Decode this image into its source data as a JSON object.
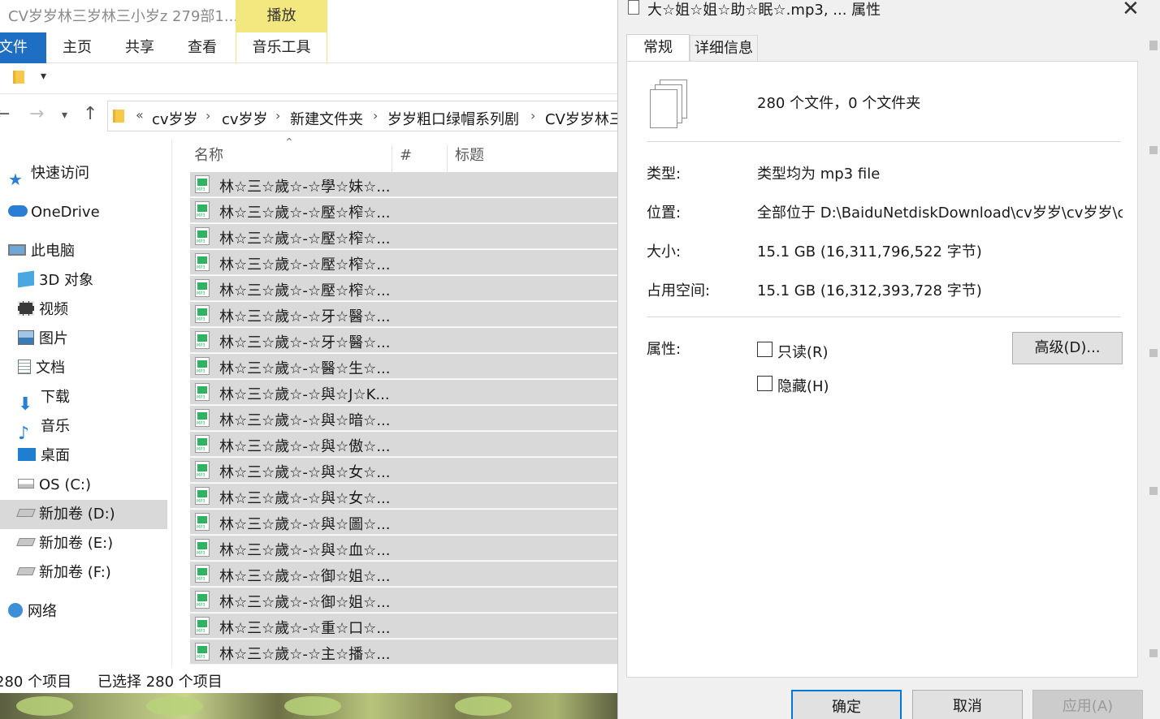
{
  "explorer": {
    "title": "CV岁岁林三岁林三小岁z 279部1...",
    "play_tab": "播放",
    "ribbon": {
      "file": "文件",
      "home": "主页",
      "share": "共享",
      "view": "查看",
      "music_tools": "音乐工具"
    },
    "address": {
      "overflow": "«",
      "segments": [
        "cv岁岁",
        "cv岁岁",
        "新建文件夹",
        "岁岁粗口绿帽系列剧",
        "CV岁岁林三"
      ]
    },
    "sidebar": [
      {
        "label": "快速访问",
        "icon": "star-icon"
      },
      {
        "label": "OneDrive",
        "icon": "cloud-icon"
      },
      {
        "label": "此电脑",
        "icon": "computer-icon"
      },
      {
        "label": "3D 对象",
        "icon": "cube-icon"
      },
      {
        "label": "视频",
        "icon": "video-icon"
      },
      {
        "label": "图片",
        "icon": "picture-icon"
      },
      {
        "label": "文档",
        "icon": "document-icon"
      },
      {
        "label": "下载",
        "icon": "download-icon"
      },
      {
        "label": "音乐",
        "icon": "music-icon"
      },
      {
        "label": "桌面",
        "icon": "desktop-icon"
      },
      {
        "label": "OS (C:)",
        "icon": "drive-c-icon"
      },
      {
        "label": "新加卷 (D:)",
        "icon": "drive-icon"
      },
      {
        "label": "新加卷 (E:)",
        "icon": "drive-icon"
      },
      {
        "label": "新加卷 (F:)",
        "icon": "drive-icon"
      },
      {
        "label": "网络",
        "icon": "network-icon"
      }
    ],
    "columns": {
      "name": "名称",
      "number": "#",
      "title": "标题"
    },
    "files": [
      "林☆三☆歲☆-☆學☆妹☆...",
      "林☆三☆歲☆-☆壓☆榨☆...",
      "林☆三☆歲☆-☆壓☆榨☆...",
      "林☆三☆歲☆-☆壓☆榨☆...",
      "林☆三☆歲☆-☆壓☆榨☆...",
      "林☆三☆歲☆-☆牙☆醫☆...",
      "林☆三☆歲☆-☆牙☆醫☆...",
      "林☆三☆歲☆-☆醫☆生☆...",
      "林☆三☆歲☆-☆與☆J☆K...",
      "林☆三☆歲☆-☆與☆暗☆...",
      "林☆三☆歲☆-☆與☆傲☆...",
      "林☆三☆歲☆-☆與☆女☆...",
      "林☆三☆歲☆-☆與☆女☆...",
      "林☆三☆歲☆-☆與☆圖☆...",
      "林☆三☆歲☆-☆與☆血☆...",
      "林☆三☆歲☆-☆御☆姐☆...",
      "林☆三☆歲☆-☆御☆姐☆...",
      "林☆三☆歲☆-☆重☆口☆...",
      "林☆三☆歲☆-☆主☆播☆..."
    ],
    "status": {
      "count": "280 个项目",
      "selected": "已选择 280 个项目"
    }
  },
  "dialog": {
    "title": "大☆姐☆姐☆助☆眠☆.mp3, ... 属性",
    "tabs": {
      "general": "常规",
      "details": "详细信息"
    },
    "summary": "280 个文件，0 个文件夹",
    "type_label": "类型:",
    "type_value": "类型均为 mp3 file",
    "location_label": "位置:",
    "location_value": "全部位于 D:\\BaiduNetdiskDownload\\cv岁岁\\cv岁岁\\cv",
    "size_label": "大小:",
    "size_value": "15.1 GB (16,311,796,522 字节)",
    "disk_label": "占用空间:",
    "disk_value": "15.1 GB (16,312,393,728 字节)",
    "attr_label": "属性:",
    "readonly": "只读(R)",
    "hidden": "隐藏(H)",
    "advanced": "高级(D)...",
    "ok": "确定",
    "cancel": "取消",
    "apply": "应用(A)"
  }
}
